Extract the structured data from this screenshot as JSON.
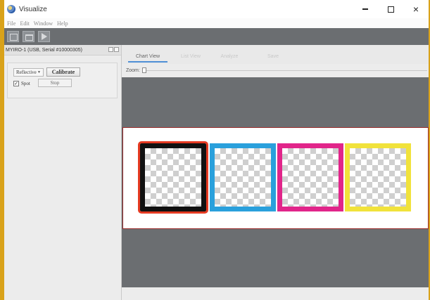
{
  "window": {
    "title": "Visualize",
    "controls": {
      "minimize": "minimize",
      "maximize": "maximize",
      "close": "×"
    }
  },
  "menu": [
    "File",
    "Edit",
    "Window",
    "Help"
  ],
  "toolbar": {
    "icons": [
      "report-icon",
      "window-icon",
      "document-icon"
    ]
  },
  "device": {
    "header": "MYIRO-1 (USB, Serial #10000305)",
    "mode_select": "Reflective",
    "calibrate_label": "Calibrate",
    "spot_label": "Spot",
    "spot_checked": true,
    "stop_label": "Stop"
  },
  "tabs": [
    {
      "label": "Chart View",
      "active": true
    },
    {
      "label": "List View",
      "active": false
    },
    {
      "label": "Analyze",
      "active": false
    },
    {
      "label": "Save",
      "active": false
    }
  ],
  "zoom": {
    "label": "Zoom:",
    "value": 0
  },
  "patches": [
    {
      "color": "#111111",
      "selected": true
    },
    {
      "color": "#2aa0dc",
      "selected": false
    },
    {
      "color": "#e1258a",
      "selected": false
    },
    {
      "color": "#f1e23b",
      "selected": false
    }
  ]
}
